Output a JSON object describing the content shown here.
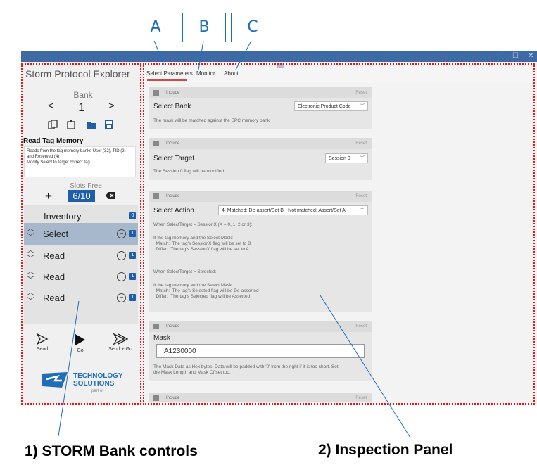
{
  "annotations": {
    "boxes": [
      "A",
      "B",
      "C"
    ],
    "bottom_left_label": "1) STORM Bank controls",
    "bottom_right_label": "2) Inspection Panel"
  },
  "window": {
    "title_controls": {
      "minimize": "–",
      "maximize": "☐",
      "close": "✕"
    }
  },
  "left_panel": {
    "app_title": "Storm Protocol Explorer",
    "bank_label": "Bank",
    "bank_prev": "<",
    "bank_number": "1",
    "bank_next": ">",
    "section_title": "Read Tag Memory",
    "section_desc": "Reads from the tag memory banks User (32), TID (2) and Reserved (4)\nModify Select to target correct tag.",
    "slots_free_label": "Slots Free",
    "slots_free_value": "6/10",
    "add_symbol": "+",
    "slots": [
      {
        "name": "Inventory",
        "badge": "0"
      },
      {
        "name": "Select",
        "badge": "1"
      },
      {
        "name": "Read",
        "badge": "1"
      },
      {
        "name": "Read",
        "badge": "1"
      },
      {
        "name": "Read",
        "badge": "1"
      }
    ],
    "actions": {
      "send": "Send",
      "go": "Go",
      "send_go": "Send + Go"
    },
    "logo": {
      "line1": "TECHNOLOGY",
      "line2": "SOLUTIONS",
      "sub": "part of"
    }
  },
  "tabs": [
    "Select Parameters",
    "Monitor",
    "About"
  ],
  "cards": {
    "include_label": "Include",
    "reset_label": "Reset",
    "select_bank": {
      "label": "Select Bank",
      "value": "Electronic Product Code",
      "desc": "The mask will be matched against the EPC memory bank"
    },
    "select_target": {
      "label": "Select Target",
      "value": "Session 0",
      "desc": "The Session 0 flag will be modified"
    },
    "select_action": {
      "label": "Select Action",
      "value": "4: Matched: De-assert/Set B - Not matched: Assert/Set A",
      "desc_1": "When SelectTarget = SessionX (X = 0, 1, 2 or 3):",
      "desc_2": "If the tag memory and the Select Mask:\n  Match:  The tag's SessionX flag will be set to B\n  Differ:  The tag's SessionX flag will be set to A",
      "desc_3": "When SelectTarget = Selected:",
      "desc_4": "If the tag memory and the Select Mask:\n  Match:  The tag's Selected flag will be De-asserted\n  Differ:  The tag's Selected flag will be Asserted"
    },
    "mask": {
      "label": "Mask",
      "value": "A1230000",
      "desc": "The Mask Data as Hex bytes. Data will be padded with '0' from the right if it is too short. Set\nthe Mask Length and Mask Offset too."
    }
  },
  "colors": {
    "accent": "#1f5fa8",
    "titlebar": "#3e6ba5",
    "annotation": "#1f6fb8",
    "frame": "#e01818",
    "tab_active": "#d04a4a"
  }
}
